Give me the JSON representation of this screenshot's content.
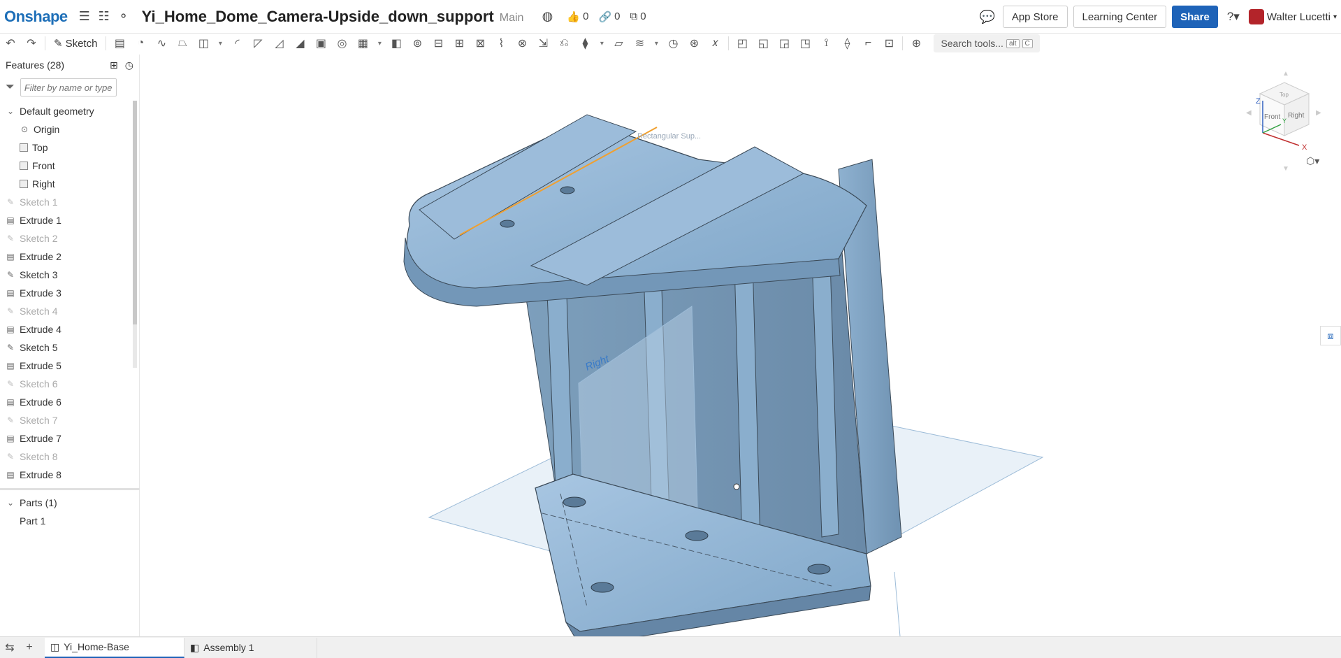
{
  "topbar": {
    "logo": "Onshape",
    "doc_title": "Yi_Home_Dome_Camera-Upside_down_support",
    "branch": "Main",
    "likes": "0",
    "links": "0",
    "copies": "0",
    "app_store": "App Store",
    "learning_center": "Learning Center",
    "share": "Share",
    "user_name": "Walter Lucetti"
  },
  "toolbar": {
    "sketch_label": "Sketch",
    "search_placeholder": "Search tools...",
    "kbd_alt": "alt",
    "kbd_c": "C"
  },
  "features": {
    "header": "Features (28)",
    "filter_placeholder": "Filter by name or type",
    "default_geometry": "Default geometry",
    "origin": "Origin",
    "planes": [
      "Top",
      "Front",
      "Right"
    ],
    "items": [
      {
        "label": "Sketch 1",
        "type": "sketch",
        "dim": true
      },
      {
        "label": "Extrude 1",
        "type": "extrude",
        "dim": false
      },
      {
        "label": "Sketch 2",
        "type": "sketch",
        "dim": true
      },
      {
        "label": "Extrude 2",
        "type": "extrude",
        "dim": false
      },
      {
        "label": "Sketch 3",
        "type": "sketch",
        "dim": false
      },
      {
        "label": "Extrude 3",
        "type": "extrude",
        "dim": false
      },
      {
        "label": "Sketch 4",
        "type": "sketch",
        "dim": true
      },
      {
        "label": "Extrude 4",
        "type": "extrude",
        "dim": false
      },
      {
        "label": "Sketch 5",
        "type": "sketch",
        "dim": false
      },
      {
        "label": "Extrude 5",
        "type": "extrude",
        "dim": false
      },
      {
        "label": "Sketch 6",
        "type": "sketch",
        "dim": true
      },
      {
        "label": "Extrude 6",
        "type": "extrude",
        "dim": false
      },
      {
        "label": "Sketch 7",
        "type": "sketch",
        "dim": true
      },
      {
        "label": "Extrude 7",
        "type": "extrude",
        "dim": false
      },
      {
        "label": "Sketch 8",
        "type": "sketch",
        "dim": true
      },
      {
        "label": "Extrude 8",
        "type": "extrude",
        "dim": false
      }
    ],
    "parts_header": "Parts (1)",
    "part": "Part 1"
  },
  "viewport": {
    "plane_label": "Right",
    "sketch_label": "Rectangular Sup...",
    "cube_top": "Top",
    "cube_front": "Front",
    "cube_right": "Right",
    "axis_z": "Z",
    "axis_x": "X",
    "axis_y": "Y"
  },
  "bottom": {
    "tab1": "Yi_Home-Base",
    "tab2": "Assembly 1"
  },
  "colors": {
    "brand": "#1e6fb8",
    "share": "#1e63b8",
    "part_fill": "#8fb3d3",
    "plane": "#a9c6e0"
  }
}
